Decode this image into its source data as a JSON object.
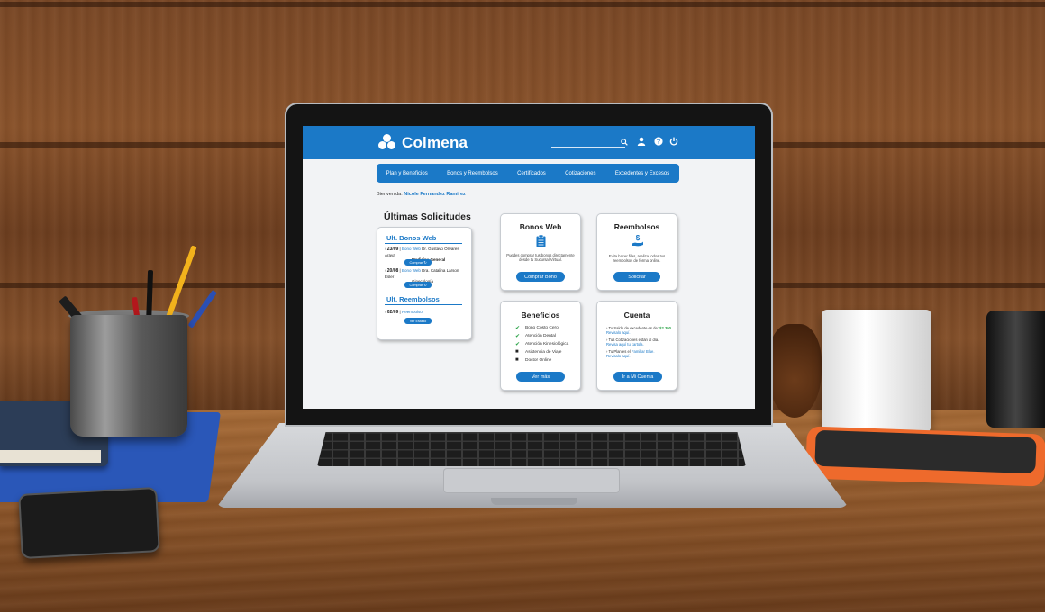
{
  "brand": {
    "name": "Colmena",
    "accent": "#1b79c7"
  },
  "header_icons": [
    "search-icon",
    "user-icon",
    "help-icon",
    "power-icon"
  ],
  "nav": [
    "Plan y Beneficios",
    "Bonos y Reembolsos",
    "Certificados",
    "Cotizaciones",
    "Excedentes y Excesos"
  ],
  "welcome": {
    "label": "Bienvenida:",
    "name": "Nicole Fernandez Ramirez"
  },
  "last_requests": {
    "title": "Últimas Solicitudes",
    "bonos_title": "Ult. Bonos Web",
    "bonos": [
      {
        "date": "23/09",
        "type": "Bono Web",
        "detail": "Dr. Gustavo Olivares Araya",
        "specialty": "Medicina General",
        "button": "Comprar"
      },
      {
        "date": "20/08",
        "type": "Bono Web",
        "detail": "Dra. Catalina Larson Esler",
        "specialty": "Ginecología",
        "button": "Comprar"
      }
    ],
    "reembolsos_title": "Ult. Reembolsos",
    "reembolsos": [
      {
        "date": "02/09",
        "type": "Reembolso",
        "button": "Ver Estado"
      }
    ]
  },
  "cards": {
    "bonos_web": {
      "title": "Bonos Web",
      "icon": "clipboard-icon",
      "text": "Puedes comprar tus bonos directamente desde tu Sucursal Virtual.",
      "button": "Comprar Bono"
    },
    "reembolsos": {
      "title": "Reembolsos",
      "icon": "hand-dollar-icon",
      "text": "Evita hacer filas, realiza todos tus reembolsos de forma online.",
      "button": "Solicitar"
    },
    "beneficios": {
      "title": "Beneficios",
      "items": [
        {
          "label": "Bono Costo Cero",
          "icon": "check-icon"
        },
        {
          "label": "Atención Dental",
          "icon": "check-icon"
        },
        {
          "label": "Atención Kinesiológica",
          "icon": "check-icon"
        },
        {
          "label": "Asistencia de Viaje",
          "icon": "lock-icon"
        },
        {
          "label": "Doctor Online",
          "icon": "lock-icon"
        }
      ],
      "button": "Ver más"
    },
    "cuenta": {
      "title": "Cuenta",
      "items": [
        {
          "text": "Tu Saldo de excedente es de:",
          "value": "$2.390",
          "link": "Revisalo aquí."
        },
        {
          "text": "Tus Cotizaciones están al día.",
          "link": "Revisa aquí tu cartola."
        },
        {
          "text": "Tu Plan es el",
          "value": "Familiar Blue.",
          "link": "Revisalo aquí."
        }
      ],
      "button": "Ir a Mi Cuenta"
    }
  }
}
